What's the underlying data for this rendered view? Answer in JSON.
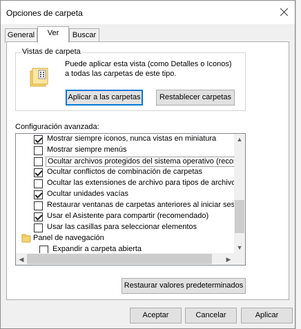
{
  "window": {
    "title": "Opciones de carpeta"
  },
  "tabs": [
    {
      "label": "General",
      "active": false
    },
    {
      "label": "Ver",
      "active": true
    },
    {
      "label": "Buscar",
      "active": false
    }
  ],
  "folder_views": {
    "legend": "Vistas de carpeta",
    "description": "Puede aplicar esta vista (como Detalles o Iconos) a todas las carpetas de este tipo.",
    "apply_label": "Aplicar a las carpetas",
    "reset_label": "Restablecer carpetas"
  },
  "advanced": {
    "label": "Configuración avanzada:",
    "items": [
      {
        "label": "Mostrar siempre iconos, nunca vistas en miniatura",
        "checked": true
      },
      {
        "label": "Mostrar siempre menús",
        "checked": false
      },
      {
        "label": "Ocultar archivos protegidos del sistema operativo (recomendado)",
        "checked": false,
        "selected": true
      },
      {
        "label": "Ocultar conflictos de combinación de carpetas",
        "checked": true
      },
      {
        "label": "Ocultar las extensiones de archivo para tipos de archivo conocidos",
        "checked": false
      },
      {
        "label": "Ocultar unidades vacías",
        "checked": true
      },
      {
        "label": "Restaurar ventanas de carpetas anteriores al iniciar sesión",
        "checked": false
      },
      {
        "label": "Usar el Asistente para compartir (recomendado)",
        "checked": true
      },
      {
        "label": "Usar las casillas para seleccionar elementos",
        "checked": false
      }
    ],
    "node": {
      "label": "Panel de navegación"
    },
    "node_items": [
      {
        "label": "Expandir a carpeta abierta",
        "checked": false
      }
    ]
  },
  "restore_defaults_label": "Restaurar valores predeterminados",
  "footer": {
    "ok_label": "Aceptar",
    "cancel_label": "Cancelar",
    "apply_label": "Aplicar"
  },
  "colors": {
    "accent": "#0078d7",
    "dialog_bg": "#f0f0f0",
    "folder_yellow": "#f5d271"
  }
}
